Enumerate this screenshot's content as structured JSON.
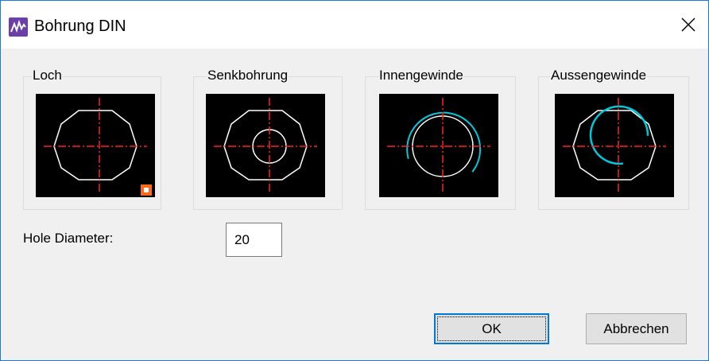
{
  "window": {
    "title": "Bohrung DIN",
    "icon": "app-logo-icon",
    "close_icon": "close-icon"
  },
  "options": [
    {
      "label": "Loch",
      "selected": true
    },
    {
      "label": "Senkbohrung",
      "selected": false
    },
    {
      "label": "Innengewinde",
      "selected": false
    },
    {
      "label": "Aussengewinde",
      "selected": false
    }
  ],
  "diameter": {
    "label": "Hole Diameter:",
    "value": "20"
  },
  "buttons": {
    "ok": "OK",
    "cancel": "Abbrechen"
  },
  "colors": {
    "accent": "#0078d7",
    "preview_background": "#000000",
    "centerline": "#ff0000",
    "outline": "#ffffff",
    "thread": "#00c8dc",
    "selection_marker": "#ff6a1a"
  }
}
